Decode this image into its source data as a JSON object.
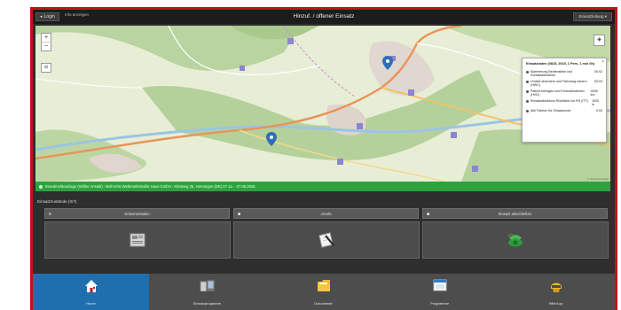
{
  "topbar": {
    "back_label": "Login",
    "small_text": "Info anzeigen",
    "title": "Hinzuf. / offener Einsatz",
    "user_menu": "Einsatzleitung ▾"
  },
  "map": {
    "zoom_in": "+",
    "zoom_out": "−",
    "tool": "⊟",
    "layers": "◈",
    "credit": "© OpenStreetMap",
    "popup": {
      "close": "×",
      "title": "Einsatzdaten (0815, 2015, 1 Pers, 1 min 0h)",
      "rows": [
        {
          "label": "Alarmierung Bedienstelle und Kontaktaufnahme",
          "value": "00:02"
        },
        {
          "label": "Umfeld absichern und Fahrzeug sichern (HWC)",
          "value": "00:04"
        },
        {
          "label": "Patient befragen und Erstmaßnahmen (HVD)",
          "value": "0008 km"
        },
        {
          "label": "Einsatzabschluss Rückfahrt zur RS (ITT)",
          "value": "1000 m"
        },
        {
          "label": "Alle Fahrten für Einsatzende",
          "value": "0:00"
        }
      ]
    }
  },
  "status": {
    "text": "Brandmeldeanlage (Stiftler Anstalt) - Bell-Grist Weltmarktstraße Haus GmbH - Klettweg 25, Herrengen (DE) 07.12. - 07.05.2025"
  },
  "panel": {
    "section_label": "Einsatzzustände (0/7)",
    "actions": [
      {
        "mark": "≡",
        "label": "Dokumentation"
      },
      {
        "mark": "■",
        "label": "Anrufe"
      },
      {
        "mark": "■",
        "label": "Einsatz abschließen"
      }
    ]
  },
  "nav": {
    "items": [
      {
        "label": "Home",
        "icon": "home-icon"
      },
      {
        "label": "Einsatzprogramm",
        "icon": "devices-icon"
      },
      {
        "label": "Dokumente",
        "icon": "folder-icon"
      },
      {
        "label": "Programme",
        "icon": "window-icon"
      },
      {
        "label": "Hilfe/Lup",
        "icon": "helmet-icon"
      }
    ]
  },
  "colors": {
    "accent": "#1f6fae",
    "status_green": "#2ea33d",
    "frame_red": "#c0141c"
  }
}
